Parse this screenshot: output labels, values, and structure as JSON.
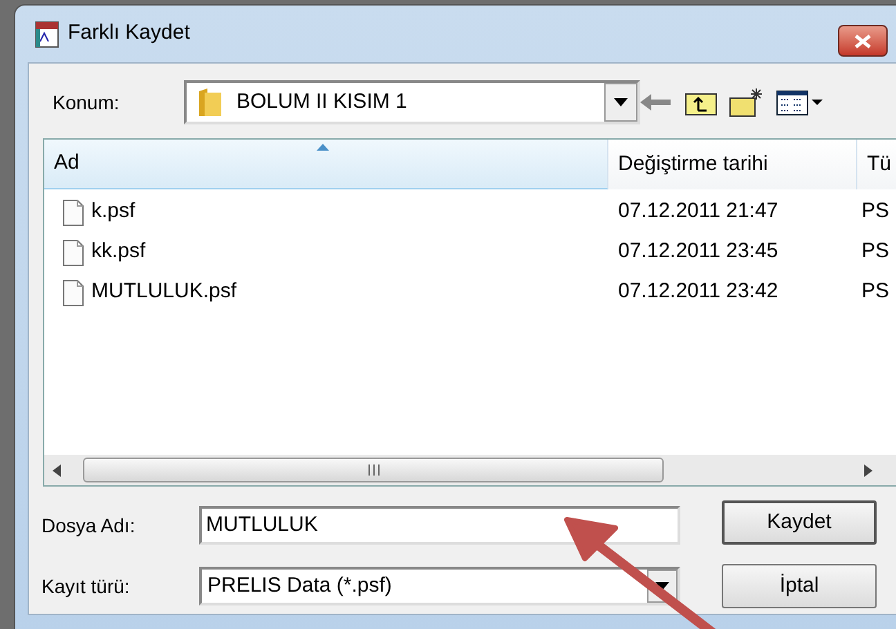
{
  "window": {
    "title": "Farklı Kaydet"
  },
  "location": {
    "label": "Konum:",
    "value": "BOLUM II KISIM 1"
  },
  "file_list": {
    "columns": [
      {
        "label": "Ad",
        "sorted": true
      },
      {
        "label": "Değiştirme tarihi",
        "sorted": false
      },
      {
        "label": "Tü",
        "sorted": false
      }
    ],
    "rows": [
      {
        "name": "k.psf",
        "modified": "07.12.2011 21:47",
        "column_3": "PS"
      },
      {
        "name": "kk.psf",
        "modified": "07.12.2011 23:45",
        "column_3": "PS"
      },
      {
        "name": "MUTLULUK.psf",
        "modified": "07.12.2011 23:42",
        "column_3": "PS"
      }
    ]
  },
  "file_name": {
    "label": "Dosya Adı:",
    "value": "MUTLULUK"
  },
  "file_type": {
    "label": "Kayıt türü:",
    "value": "PRELIS Data (*.psf)"
  },
  "buttons": [
    "Kaydet",
    "İptal"
  ]
}
